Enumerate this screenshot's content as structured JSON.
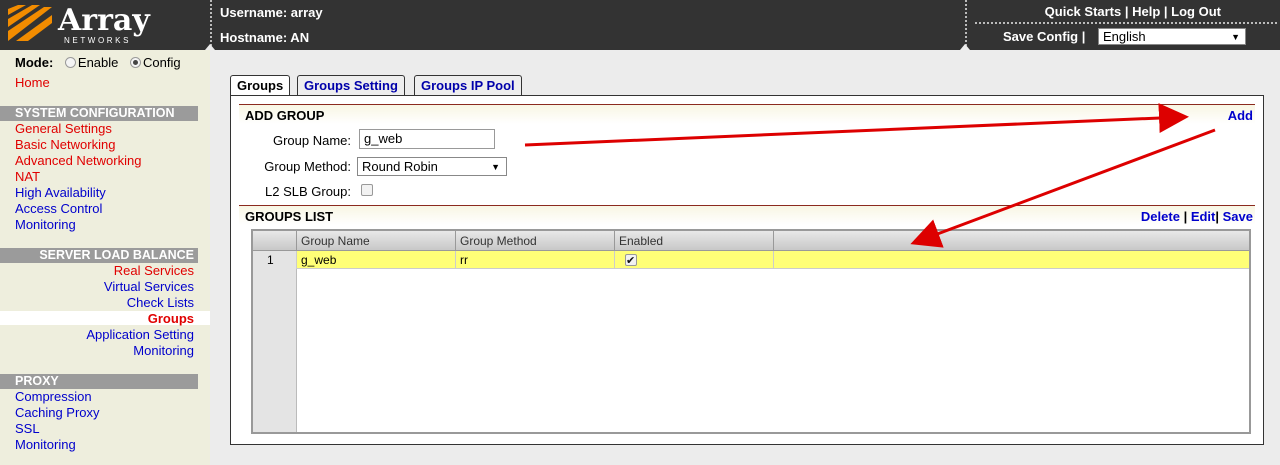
{
  "header": {
    "logo_text": "Array",
    "logo_sub": "NETWORKS",
    "username_label": "Username: array",
    "hostname_label": "Hostname: AN",
    "links": [
      "Quick Starts",
      "Help",
      "Log Out"
    ],
    "separator": " | ",
    "save_config": "Save Config",
    "language": "English"
  },
  "sidebar": {
    "mode_label": "Mode:",
    "mode_enable": "Enable",
    "mode_config": "Config",
    "mode_selected": "Config",
    "home": "Home",
    "system_configuration": {
      "title": "SYSTEM CONFIGURATION",
      "items": [
        "General Settings",
        "Basic Networking",
        "Advanced Networking",
        "NAT",
        "High Availability",
        "Access Control",
        "Monitoring"
      ]
    },
    "server_load_balance": {
      "title": "SERVER LOAD BALANCE",
      "items": [
        "Real Services",
        "Virtual Services",
        "Check Lists",
        "Groups",
        "Application Setting",
        "Monitoring"
      ],
      "selected": "Groups"
    },
    "proxy": {
      "title": "PROXY",
      "items": [
        "Compression",
        "Caching Proxy",
        "SSL",
        "Monitoring"
      ]
    }
  },
  "tabs": [
    "Groups",
    "Groups Setting",
    "Groups IP Pool"
  ],
  "active_tab": "Groups",
  "add_group": {
    "title": "ADD GROUP",
    "add_link": "Add",
    "name_label": "Group Name:",
    "name_value": "g_web",
    "method_label": "Group Method:",
    "method_value": "Round Robin",
    "l2_label": "L2 SLB Group:",
    "l2_checked": false
  },
  "groups_list": {
    "title": "GROUPS LIST",
    "links": [
      "Delete",
      "Edit",
      "Save"
    ],
    "columns": [
      "Group Name",
      "Group Method",
      "Enabled"
    ],
    "rows": [
      {
        "num": "1",
        "name": "g_web",
        "method": "rr",
        "enabled": true
      }
    ]
  },
  "colors": {
    "header_bg": "#333333",
    "sidebar_bg": "#eeeedd",
    "link_blue": "#0000cc",
    "link_red": "#e00000",
    "row_highlight": "#ffff77",
    "annotation_arrow": "#dd0000"
  }
}
